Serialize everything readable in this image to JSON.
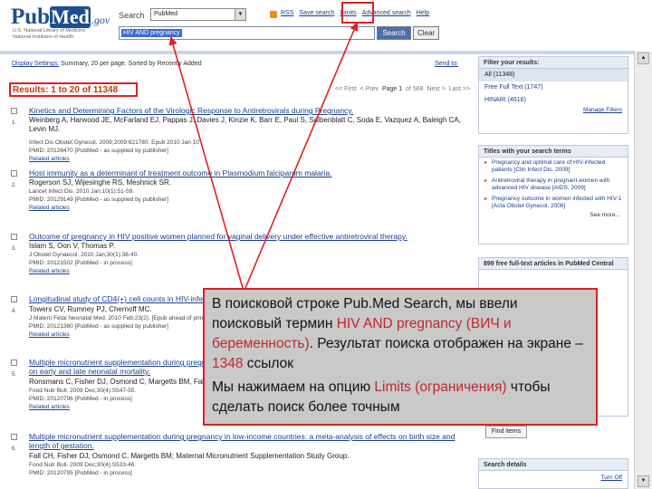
{
  "header": {
    "logo_pub": "Pub",
    "logo_med": "Med",
    "logo_gov": ".gov",
    "nlm_line1": "U.S. National Library of Medicine",
    "nlm_line2": "National Institutes of Health",
    "search_label": "Search",
    "db_value": "PubMed",
    "links": [
      "RSS",
      "Save search",
      "Limits",
      "Advanced search",
      "Help"
    ],
    "query": "HIV AND pregnancy",
    "search_button": "Search",
    "clear_button": "Clear"
  },
  "toolbar": {
    "display_settings": "Display Settings:",
    "summary": "Summary, 20 per page, Sorted by Recently Added",
    "send_to": "Send to:",
    "results": "Results: 1 to 20 of 11348",
    "pager": {
      "first": "<< First",
      "prev": "< Prev",
      "page": "Page 1",
      "of": "of 568",
      "next": "Next >",
      "last": "Last >>"
    }
  },
  "results": [
    {
      "num": "1.",
      "title": "Kinetics and Determining Factors of the Virologic Response to Antiretrovirals during Pregnancy.",
      "authors": "Weinberg A, Harwood JE, McFarland EJ, Pappas J, Davies J, Kinzie K, Barr E, Paul S, Salbenblatt C, Soda E, Vazquez A, Baleigh CA, Levin MJ.",
      "journal": "Infect Dis Obstet Gynecol. 2009;2009:621780. Epub 2010 Jan 10",
      "pmid": "PMID: 20126470 [PubMed - as supplied by publisher]",
      "related": "Related articles"
    },
    {
      "num": "2.",
      "title": "Host immunity as a determinant of treatment outcome in Plasmodium falciparum malaria.",
      "authors": "Rogerson SJ, Wijesinghe RS, Meshnick SR.",
      "journal": "Lancet Infect Dis. 2010 Jan;10(1):51-59.",
      "pmid": "PMID: 20129149 [PubMed - as supplied by publisher]",
      "related": "Related articles"
    },
    {
      "num": "3.",
      "title": "Outcome of pregnancy in HIV positive women planned for vaginal delivery under effective antiretroviral therapy.",
      "authors": "Islam S, Oon V, Thomas P.",
      "journal": "J Obstet Gynaecol. 2010 Jan;30(1):38-40.",
      "pmid": "PMID: 20121502 [PubMed - in process]",
      "related": "Related articles"
    },
    {
      "num": "4.",
      "title": "Longitudinal study of CD4(+) cell counts in HIV-infected pregnant women",
      "authors": "Towers CV, Rumney PJ, Chernoff MC.",
      "journal": "J Matern Fetal Neonatal Med. 2010 Feb;23(2). [Epub ahead of print]",
      "pmid": "PMID: 20121380 [PubMed - as supplied by publisher]",
      "related": "Related articles"
    },
    {
      "num": "5.",
      "title": "Multiple micronutrient supplementation during pregnancy in low-income countries: a meta-analysis of effects on stillbirths and on early and late neonatal mortality.",
      "authors": "Ronsmans C, Fisher DJ, Osmond C, Margetts BM, Fall CH.",
      "journal": "Food Nutr Bull. 2009 Dec;30(4):S547-55.",
      "pmid": "PMID: 20120796 [PubMed - in process]",
      "related": "Related articles"
    },
    {
      "num": "6.",
      "title": "Multiple micronutrient supplementation during pregnancy in low-income countries: a meta-analysis of effects on birth size and length of gestation.",
      "authors": "Fall CH, Fisher DJ, Osmond C, Margetts BM; Maternal Micronutrient Supplementation Study Group.",
      "journal": "Food Nutr Bull. 2009 Dec;30(4):S533-46.",
      "pmid": "PMID: 20120795 [PubMed - in process]",
      "related": "Related articles"
    }
  ],
  "sidebar": {
    "filter_head": "Filter your results:",
    "filters": [
      "All (11348)",
      "Free Full Text (1747)",
      "HINARI (4616)"
    ],
    "manage": "Manage Filters",
    "titles_head": "Titles with your search terms",
    "titles": [
      "Pregnancy and optimal care of HIV-infected patients [Clin Infect Dis. 2009]",
      "Antiretroviral therapy in pregnant women with advanced HIV disease [AIDS. 2009]",
      "Pregnancy outcome in women infected with HIV-1 [Acta Obstet Gynecol. 2008]"
    ],
    "see_more": "See more...",
    "free_head": "899 free full-text articles in PubMed Central",
    "find_items": "Find items",
    "details_head": "Search details",
    "turn_off": "Turn Off"
  },
  "callout": {
    "p1_a": "В поисковой строке  Pub.Med Search, мы ввели поисковый термин  ",
    "p1_hl1": "HIV AND pregnancy (ВИЧ и беременность)",
    "p1_b": ".  Результат поиска отображен на экране – ",
    "p1_hl2": "1348",
    "p1_c": "  ссылок",
    "p2_a": "Мы нажимаем на опцию  ",
    "p2_hl": "Limits (ограничения)",
    "p2_b": " чтобы  сделать поиск более точным"
  },
  "colors": {
    "accent_red": "#e02020",
    "link_blue": "#1a3e8c",
    "result_orange": "#c23a0c"
  }
}
